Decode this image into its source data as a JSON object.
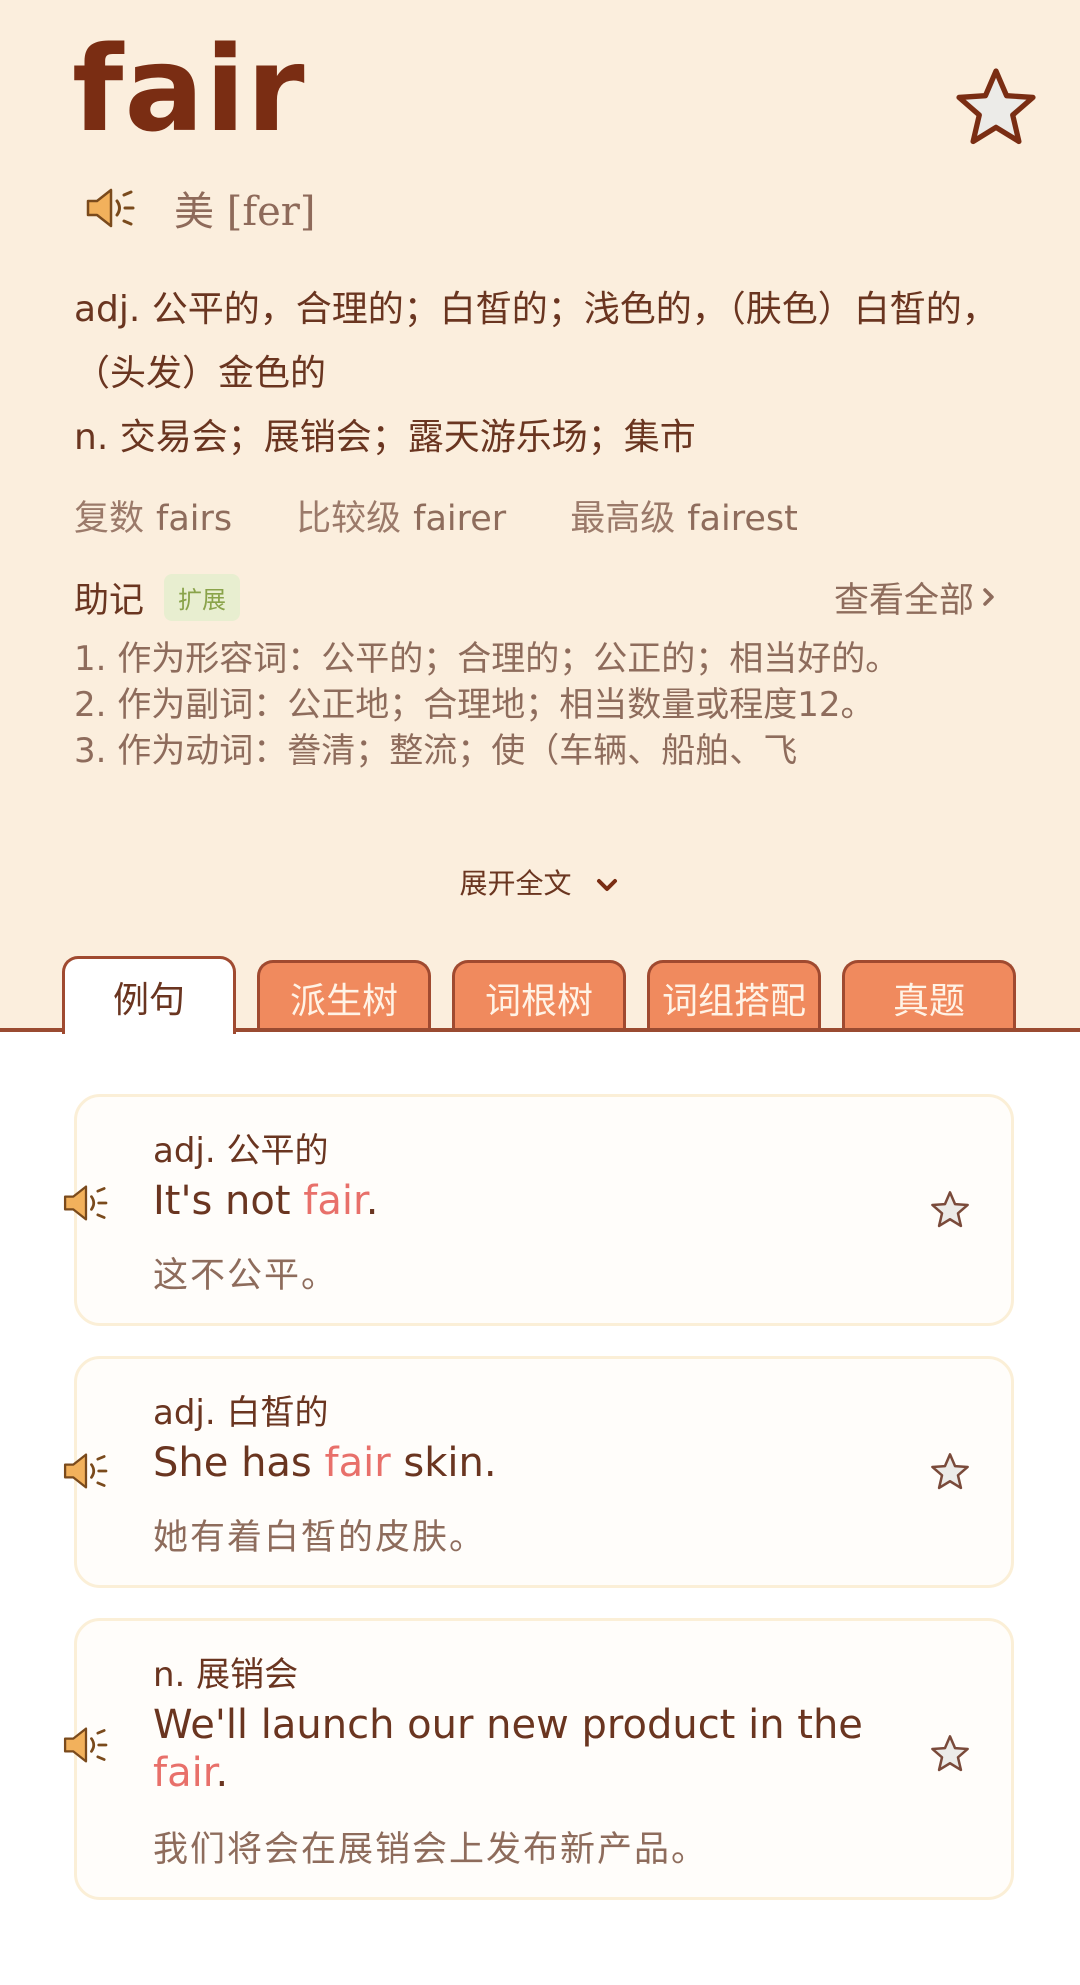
{
  "word": "fair",
  "phonetic": "美 [fer]",
  "definitions": [
    "adj. 公平的，合理的；白皙的；浅色的，（肤色）白皙的，（头发）金色的",
    "n. 交易会；展销会；露天游乐场；集市"
  ],
  "forms": [
    {
      "label": "复数",
      "value": "fairs"
    },
    {
      "label": "比较级",
      "value": "fairer"
    },
    {
      "label": "最高级",
      "value": "fairest"
    }
  ],
  "mnemonic": {
    "title": "助记",
    "badge": "扩展",
    "see_all": "查看全部",
    "lines": [
      "1. 作为形容词：公平的；合理的；公正的；相当好的。",
      "2. 作为副词：公正地；合理地；相当数量或程度12。",
      "3. 作为动词：誊清；整流；使（车辆、船舶、飞"
    ],
    "expand_label": "展开全文"
  },
  "tabs": [
    "例句",
    "派生树",
    "词根树",
    "词组搭配",
    "真题"
  ],
  "examples": [
    {
      "pos": "adj. 公平的",
      "en_before": "It's not ",
      "en_hl": "fair",
      "en_after": ".",
      "cn": "这不公平。"
    },
    {
      "pos": "adj. 白皙的",
      "en_before": "She has ",
      "en_hl": "fair",
      "en_after": " skin.",
      "cn": "她有着白皙的皮肤。"
    },
    {
      "pos": "n. 展销会",
      "en_before": "We'll launch our new product in the ",
      "en_hl": "fair",
      "en_after": ".",
      "cn": "我们将会在展销会上发布新产品。"
    }
  ],
  "colors": {
    "background": "#fbeedd",
    "word": "#7a2d13",
    "highlight": "#e8706a",
    "tab": "#f08a5e",
    "badge": "#8aa34a"
  },
  "icons": {
    "speaker": "speaker-icon",
    "favorite": "star-icon",
    "chevron": "chevron-right-icon",
    "expand": "chevron-down-icon"
  }
}
